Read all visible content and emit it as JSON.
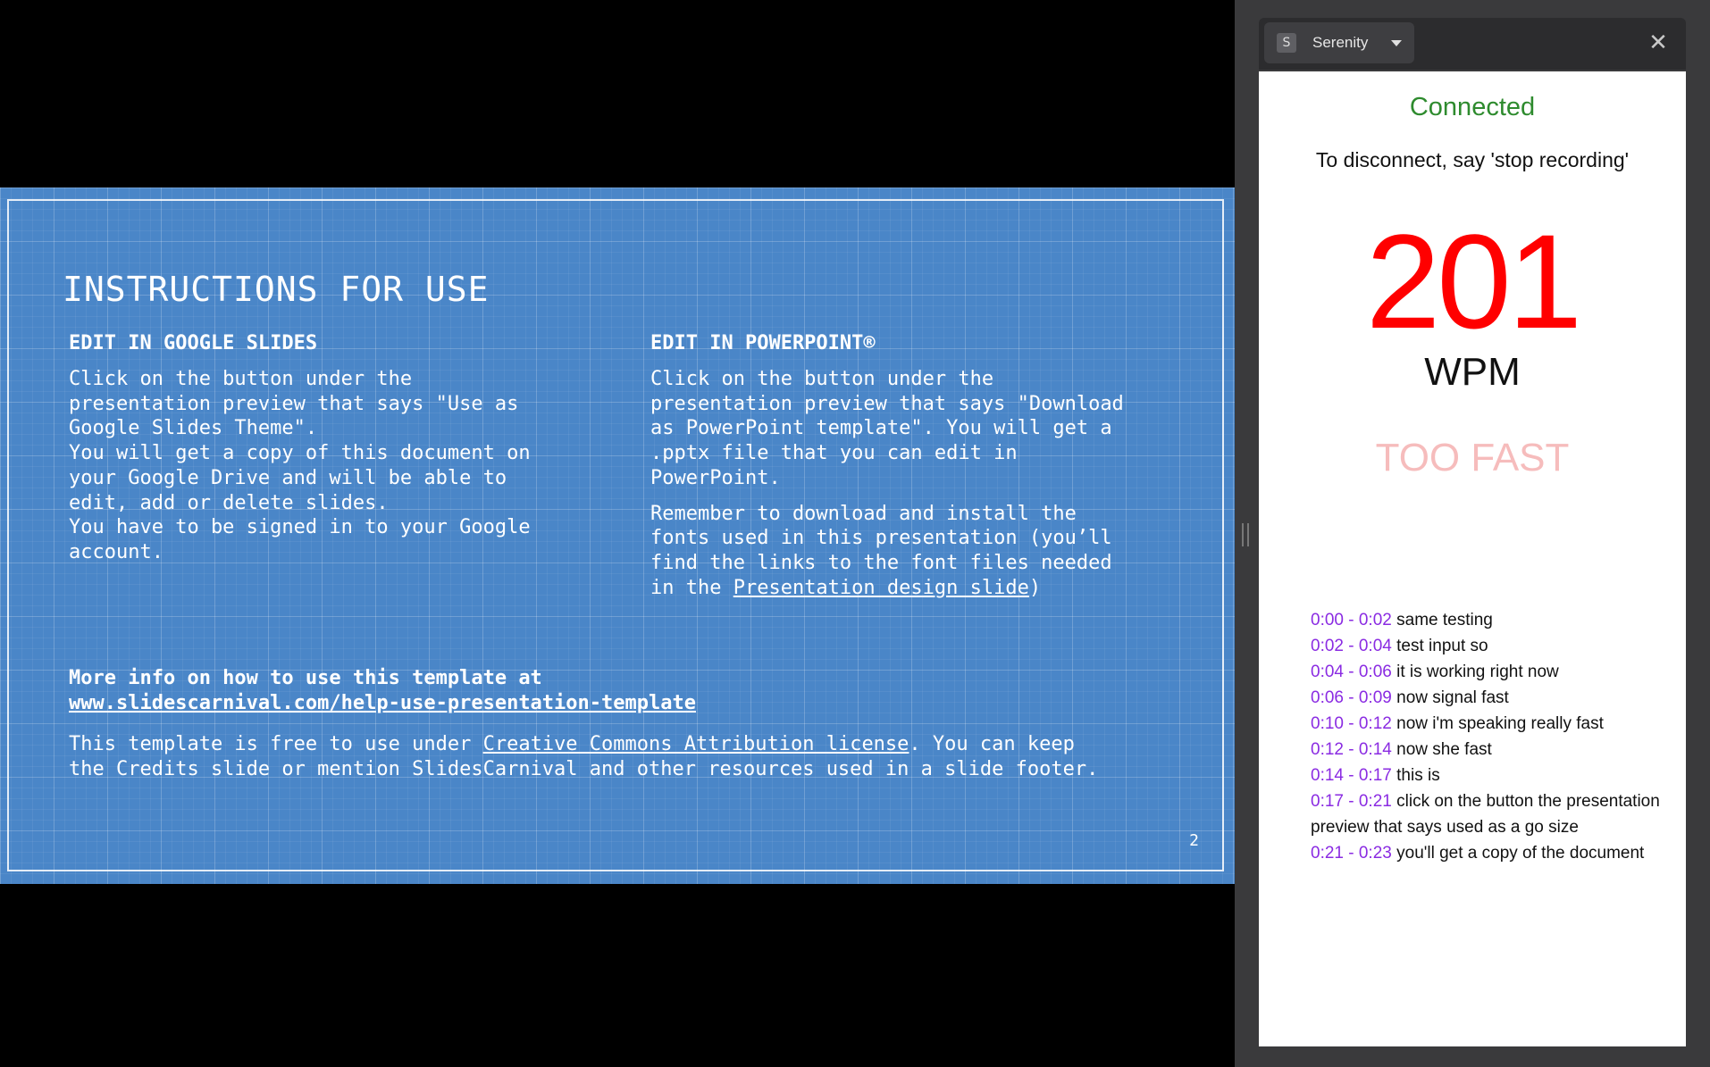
{
  "slide": {
    "title": "INSTRUCTIONS FOR USE",
    "left_heading": "EDIT IN GOOGLE SLIDES",
    "left_para1": "Click on the button under the\npresentation preview that says \"Use as\nGoogle Slides Theme\".\nYou will get a copy of this document on\nyour Google Drive and will be able to\nedit, add or delete slides.\nYou have to be signed in to your Google\naccount.",
    "right_heading": "EDIT IN POWERPOINT®",
    "right_para1": "Click on the button under the\npresentation preview that says \"Download\nas PowerPoint template\". You will get a\n.pptx file that you can edit in\nPowerPoint.",
    "right_para2_prefix": "Remember to download and install the\nfonts used in this presentation (you’ll\nfind the links to the font files needed\nin the ",
    "right_para2_link": "Presentation design slide",
    "right_para2_suffix": ")",
    "more_info": "More info on how to use this template at",
    "more_info_url": "www.slidescarnival.com/help-use-presentation-template",
    "license_prefix": "This template is free to use under ",
    "license_link": "Creative Commons Attribution license",
    "license_suffix": ". You can keep\nthe Credits slide or mention SlidesCarnival and other resources used in a slide footer.",
    "page_number": "2"
  },
  "panel": {
    "badge": "S",
    "extension_name": "Serenity",
    "close_symbol": "✕",
    "status": "Connected",
    "hint": "To disconnect, say 'stop recording'",
    "wpm": "201",
    "wpm_unit": "WPM",
    "pace": "TOO FAST",
    "transcript": [
      {
        "time": "0:00 - 0:02",
        "text": "same testing"
      },
      {
        "time": "0:02 - 0:04",
        "text": "test input so"
      },
      {
        "time": "0:04 - 0:06",
        "text": "it is working right now"
      },
      {
        "time": "0:06 - 0:09",
        "text": "now signal fast"
      },
      {
        "time": "0:10 - 0:12",
        "text": "now i'm speaking really fast"
      },
      {
        "time": "0:12 - 0:14",
        "text": "now she fast"
      },
      {
        "time": "0:14 - 0:17",
        "text": "this is"
      },
      {
        "time": "0:17 - 0:21",
        "text": "click on the button the presentation preview that says used as a go size"
      },
      {
        "time": "0:21 - 0:23",
        "text": "you'll get a copy of the document"
      }
    ]
  },
  "colors": {
    "slide_bg": "#4a86c8",
    "connected": "#2e8b2e",
    "wpm": "#ff0000",
    "pace": "#f6bcbc",
    "timestamp": "#8a2be2"
  }
}
